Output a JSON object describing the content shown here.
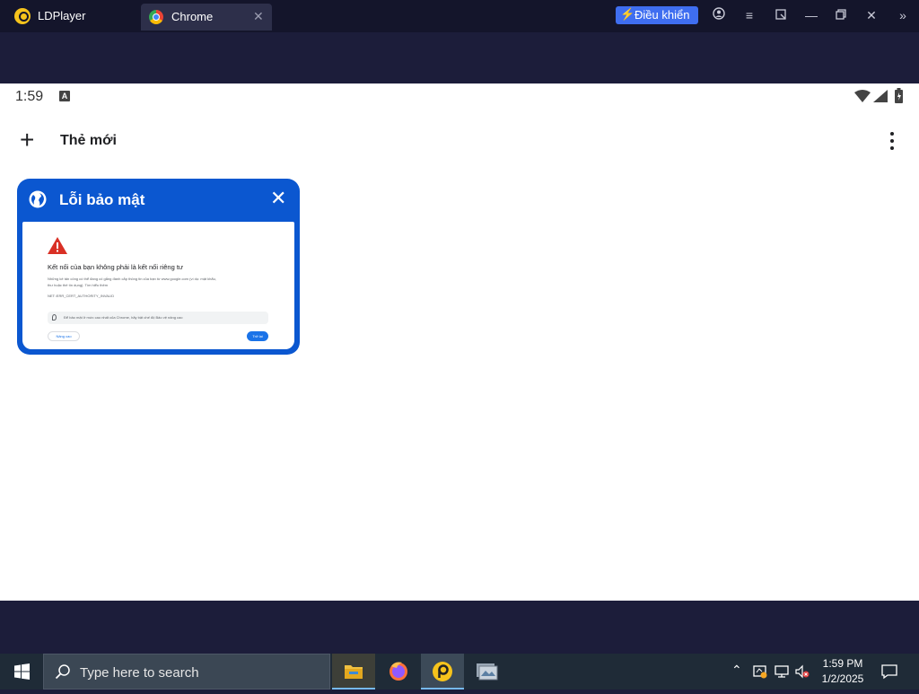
{
  "emulator": {
    "app_name": "LDPlayer",
    "tab_label": "Chrome",
    "control_button": "Điều khiển",
    "icons": [
      "account-icon",
      "menu-icon",
      "resize-icon",
      "minimize-icon",
      "restore-icon",
      "close-icon",
      "expand-icon"
    ]
  },
  "android": {
    "status_time": "1:59",
    "status_badge": "A",
    "new_tab_label": "Thẻ mới",
    "tab_card": {
      "title": "Lỗi bảo mật",
      "preview": {
        "heading": "Kết nối của bạn không phải là kết nối riêng tư",
        "line1": "Những kẻ tấn công có thể đang cố gắng đánh cắp thông tin của bạn từ www.google.com (ví dụ: mật khẩu,",
        "line2": "thư hoặc thẻ tín dụng).  Tìm hiểu thêm",
        "line3": "NET::ERR_CERT_AUTHORITY_INVALID",
        "bar_text": "Để bảo mật ở mức cao nhất của Chrome, hãy bật chế độ Bảo vệ nâng cao",
        "btn_left": "Nâng cao",
        "btn_right": "Trở lại"
      }
    }
  },
  "taskbar": {
    "search_placeholder": "Type here to search",
    "clock_time": "1:59 PM",
    "clock_date": "1/2/2025",
    "apps": [
      "file-explorer",
      "firefox",
      "ldplayer",
      "other-app"
    ]
  },
  "colors": {
    "emulator_bg": "#1c1d3a",
    "card_blue": "#0b57d0",
    "control_btn": "#3f6ef0",
    "taskbar": "#1f2b37"
  }
}
